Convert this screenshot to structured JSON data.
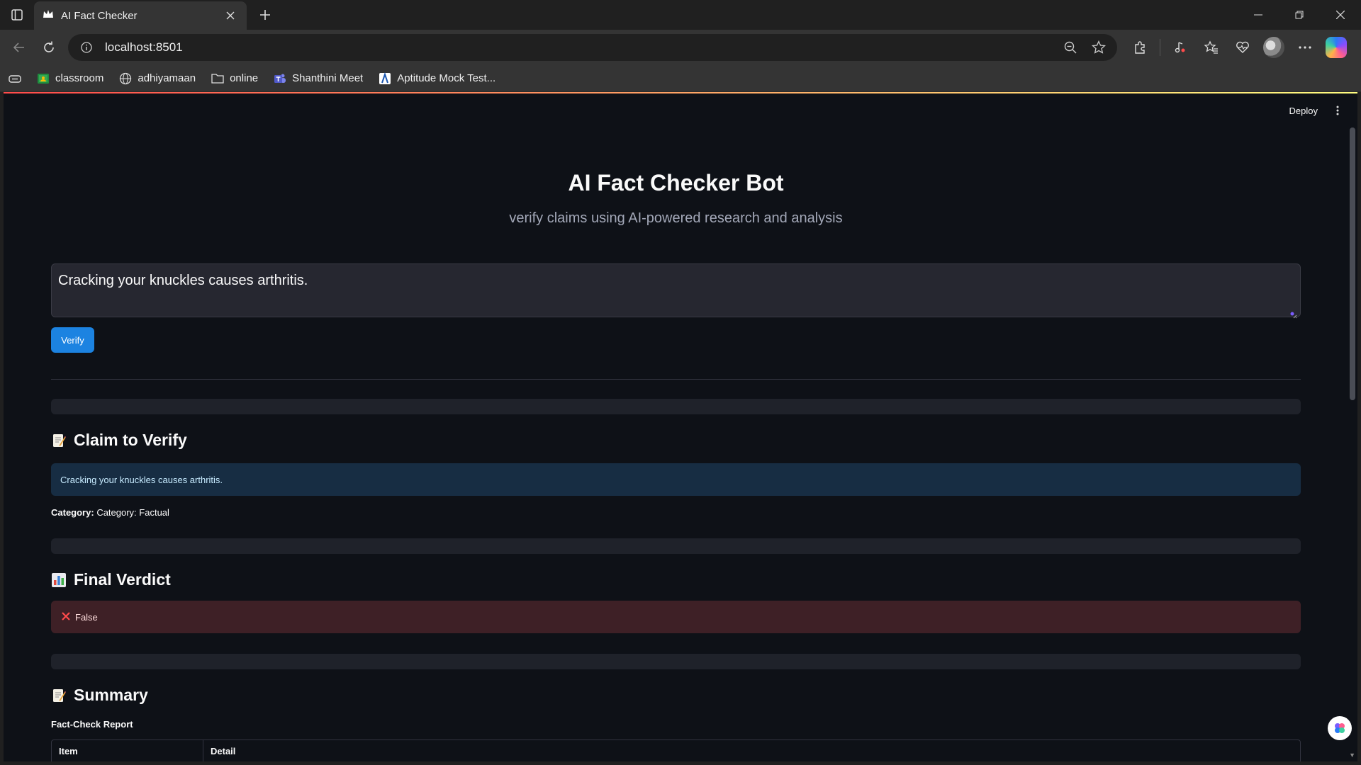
{
  "browser": {
    "tab_title": "AI Fact Checker",
    "url": "localhost:8501",
    "bookmarks": [
      {
        "label": "classroom",
        "icon": "classroom-icon"
      },
      {
        "label": "adhiyamaan",
        "icon": "globe-icon"
      },
      {
        "label": "online",
        "icon": "folder-icon"
      },
      {
        "label": "Shanthini Meet",
        "icon": "teams-icon"
      },
      {
        "label": "Aptitude Mock Test...",
        "icon": "bookmark-app-icon"
      }
    ]
  },
  "app": {
    "deploy_label": "Deploy",
    "title": "AI Fact Checker Bot",
    "subtitle": "verify claims using AI-powered research and analysis",
    "claim_input": "Cracking your knuckles causes arthritis.",
    "verify_label": "Verify",
    "claim_section": {
      "heading": "Claim to Verify",
      "claim_text": "Cracking your knuckles causes arthritis.",
      "category_label": "Category:",
      "category_value": "Category: Factual"
    },
    "verdict_section": {
      "heading": "Final Verdict",
      "verdict": "False"
    },
    "summary_section": {
      "heading": "Summary",
      "report_title": "Fact-Check Report",
      "columns": [
        "Item",
        "Detail"
      ]
    }
  },
  "colors": {
    "app_bg": "#0e1117",
    "primary_button": "#1c83e1",
    "info_bg": "#172d43",
    "error_bg": "#3e2026",
    "error_icon": "#ff4b4b"
  }
}
